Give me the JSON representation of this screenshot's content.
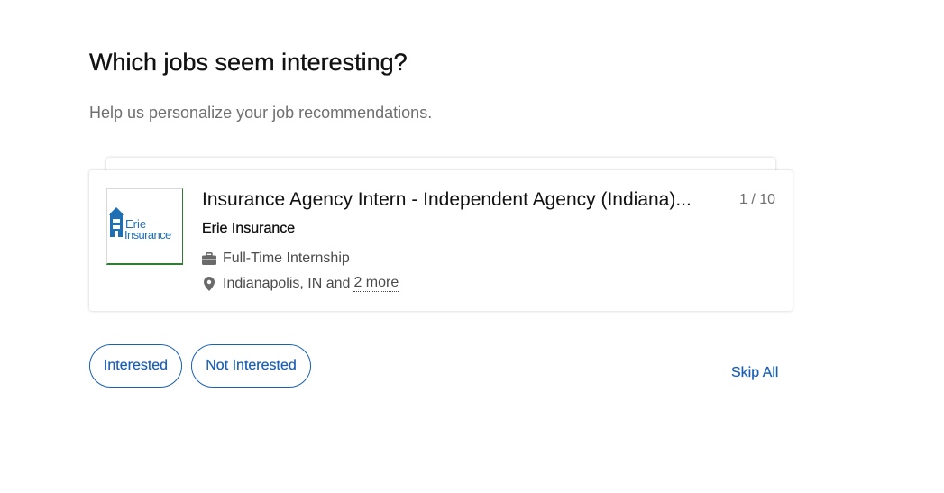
{
  "header": {
    "title": "Which jobs seem interesting?",
    "subtitle": "Help us personalize your job recommendations."
  },
  "job": {
    "title": "Insurance Agency Intern - Independent Agency (Indiana)...",
    "counter": "1 / 10",
    "company": "Erie Insurance",
    "job_type": "Full-Time Internship",
    "location": "Indianapolis, IN and",
    "more_locations": "2 more",
    "logo": {
      "line1": "Erie",
      "line2": "Insurance",
      "brand_color": "#1f6fb5"
    }
  },
  "actions": {
    "interested": "Interested",
    "not_interested": "Not Interested",
    "skip_all": "Skip All"
  },
  "icons": {
    "job_type": "briefcase-icon",
    "location": "map-pin-icon"
  },
  "colors": {
    "accent": "#1a5fb4",
    "muted_text": "#6f6f6f"
  }
}
